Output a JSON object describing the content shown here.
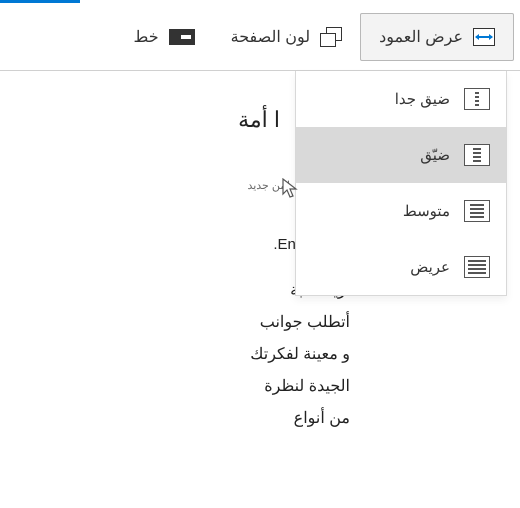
{
  "toolbar": {
    "column_width": {
      "label": "عرض العمود"
    },
    "page_color": {
      "label": "لون الصفحة"
    },
    "font": {
      "label": "خط"
    }
  },
  "dropdown": {
    "options": [
      {
        "label": "ضيق جدا",
        "id": "very-narrow"
      },
      {
        "label": "ضيّق",
        "id": "narrow"
      },
      {
        "label": "متوسط",
        "id": "medium"
      },
      {
        "label": "عريض",
        "id": "wide"
      }
    ],
    "hover_index": 1
  },
  "content": {
    "heading_fragment": "ا أمة",
    "subnote": "لمن جديد",
    "author": ".Enrico",
    "body_lines": [
      "أريد كتابة",
      "أتطلب جوانب",
      "و معينة لفكرتك",
      "الجيدة لنظرة",
      "من أنواع"
    ]
  }
}
